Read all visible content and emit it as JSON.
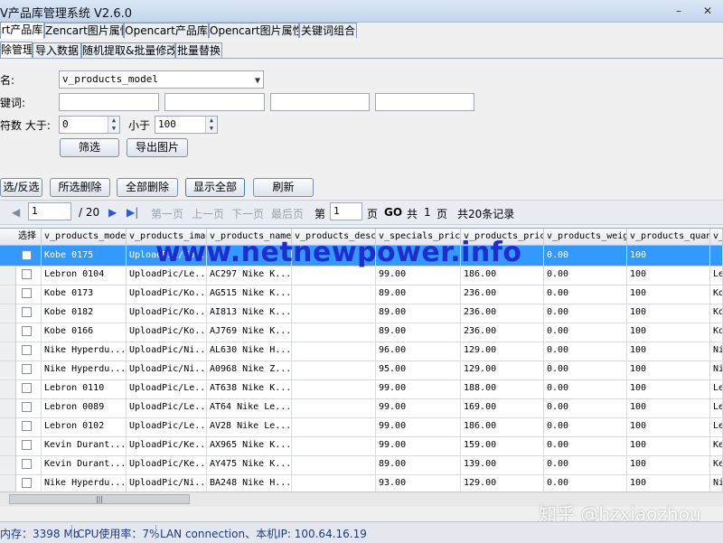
{
  "window": {
    "title": "V产品库管理系统 V2.6.0",
    "minimize": "–",
    "close": "✕"
  },
  "main_tabs": [
    {
      "label": "rt产品库",
      "active": true
    },
    {
      "label": "Zencart图片属性",
      "active": false
    },
    {
      "label": "Opencart产品库",
      "active": false
    },
    {
      "label": "Opencart图片属性",
      "active": false
    },
    {
      "label": "关键词组合",
      "active": false
    }
  ],
  "sub_tabs": [
    {
      "label": "除管理",
      "active": true
    },
    {
      "label": "导入数据",
      "active": false
    },
    {
      "label": "随机提取&批量修改",
      "active": false
    },
    {
      "label": "批量替换",
      "active": false
    }
  ],
  "form": {
    "field_label": "名:",
    "field_value": "v_products_model",
    "keyword_label": "键词:",
    "keyword_values": [
      "",
      "",
      "",
      "",
      ""
    ],
    "count_label": "符数 大于:",
    "min_value": "0",
    "max_label": "小于",
    "max_value": "100",
    "filter_button": "筛选",
    "export_button": "导出图片"
  },
  "actions": {
    "invert": "选/反选",
    "delete_selected": "所选删除",
    "delete_all": "全部删除",
    "show_all": "显示全部",
    "refresh": "刷新"
  },
  "pager": {
    "current_page": "1",
    "total_pages": "/ 20",
    "first": "第一页",
    "prev": "上一页",
    "next": "下一页",
    "last": "最后页",
    "goto_prefix": "第",
    "goto_value": "1",
    "goto_suffix": "页",
    "go": "GO",
    "total_prefix": "共",
    "total_pages_num": "1",
    "total_suffix": "页",
    "records": "共20条记录"
  },
  "grid": {
    "columns": [
      "选择",
      "v_products_model",
      "v_products_image",
      "v_products_name_",
      "v_products_desc",
      "v_specials_price",
      "v_products_price",
      "v_products_weight",
      "v_products_quan",
      "v_"
    ],
    "rows": [
      [
        "",
        "Kobe 0175",
        "UploadPic/Ko...",
        "",
        "",
        "",
        "",
        "0.00",
        "100",
        ""
      ],
      [
        "",
        "Lebron 0104",
        "UploadPic/Le...",
        "AC297 Nike K...",
        "",
        "99.00",
        "186.00",
        "0.00",
        "100",
        "Le"
      ],
      [
        "",
        "Kobe 0173",
        "UploadPic/Ko...",
        "AG515 Nike K...",
        "",
        "89.00",
        "236.00",
        "0.00",
        "100",
        "Ko"
      ],
      [
        "",
        "Kobe 0182",
        "UploadPic/Ko...",
        "AI813 Nike K...",
        "",
        "89.00",
        "236.00",
        "0.00",
        "100",
        "Ko"
      ],
      [
        "",
        "Kobe 0166",
        "UploadPic/Ko...",
        "AJ769 Nike K...",
        "",
        "89.00",
        "236.00",
        "0.00",
        "100",
        "Ko"
      ],
      [
        "",
        "Nike Hyperdu...",
        "UploadPic/Ni...",
        "AL630 Nike H...",
        "",
        "96.00",
        "129.00",
        "0.00",
        "100",
        "Ni"
      ],
      [
        "",
        "Nike Hyperdu...",
        "UploadPic/Ni...",
        "A0968 Nike Z...",
        "",
        "95.00",
        "129.00",
        "0.00",
        "100",
        "Ni"
      ],
      [
        "",
        "Lebron 0110",
        "UploadPic/Le...",
        "AT638 Nike K...",
        "",
        "99.00",
        "188.00",
        "0.00",
        "100",
        "Le"
      ],
      [
        "",
        "Lebron 0089",
        "UploadPic/Le...",
        "AT64 Nike Le...",
        "",
        "99.00",
        "169.00",
        "0.00",
        "100",
        "Le"
      ],
      [
        "",
        "Lebron 0102",
        "UploadPic/Le...",
        "AV28 Nike Le...",
        "",
        "99.00",
        "186.00",
        "0.00",
        "100",
        "Le"
      ],
      [
        "",
        "Kevin Durant...",
        "UploadPic/Ke...",
        "AX965 Nike K...",
        "",
        "99.00",
        "159.00",
        "0.00",
        "100",
        "Ke"
      ],
      [
        "",
        "Kevin Durant...",
        "UploadPic/Ke...",
        "AY475 Nike K...",
        "",
        "89.00",
        "139.00",
        "0.00",
        "100",
        "Ke"
      ],
      [
        "",
        "Nike Hyperdu...",
        "UploadPic/Ni...",
        "BA248 Nike H...",
        "",
        "93.00",
        "129.00",
        "0.00",
        "100",
        "Ni"
      ]
    ]
  },
  "watermark": "www.netnewpower.info",
  "zhihu_mark": "知乎 @hzxiaozhou",
  "status": {
    "memory": "内存：3398 Mb",
    "cpu": "CPU使用率：7%",
    "network": "LAN connection、本机IP: 100.64.16.19"
  },
  "colors": {
    "selected_row": "#3399ff",
    "watermark": "#1f2ccf",
    "status_text": "#1a3a8a"
  }
}
